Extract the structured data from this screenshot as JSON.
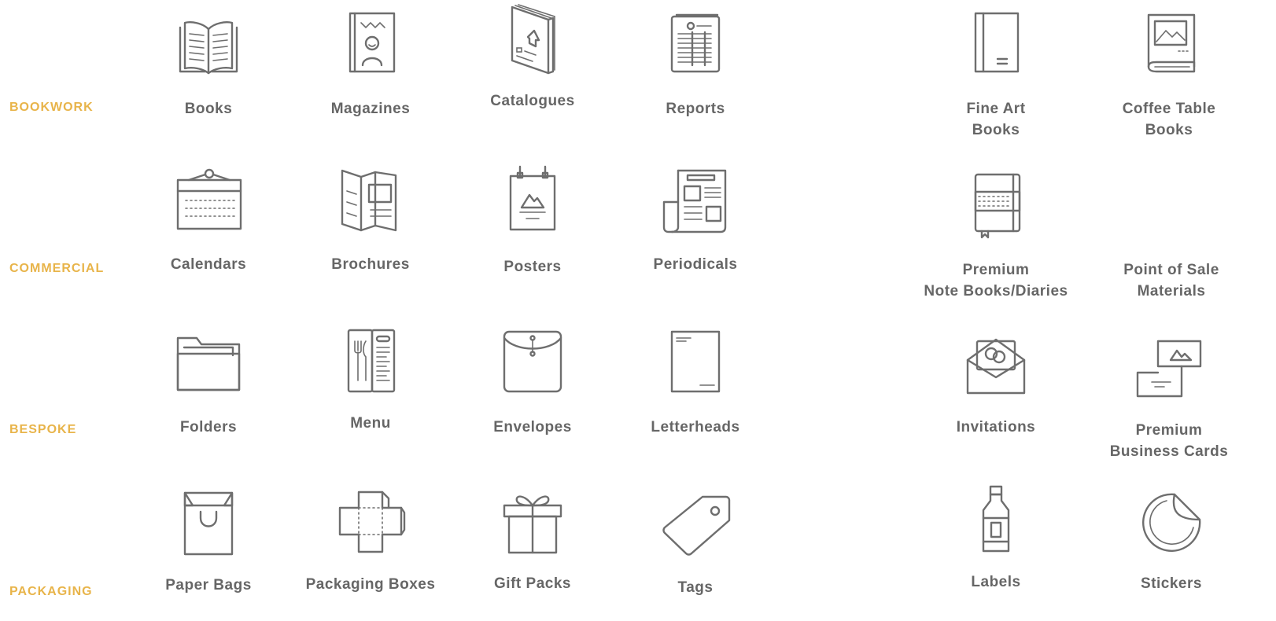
{
  "categories": [
    "BOOKWORK",
    "COMMERCIAL",
    "BESPOKE",
    "PACKAGING"
  ],
  "rows": [
    [
      {
        "label": [
          "Books"
        ],
        "icon": "open-book-icon"
      },
      {
        "label": [
          "Magazines"
        ],
        "icon": "magazine-icon"
      },
      {
        "label": [
          "Catalogues"
        ],
        "icon": "catalogue-stack-icon"
      },
      {
        "label": [
          "Reports"
        ],
        "icon": "report-icon"
      },
      {
        "label": [
          "Fine Art",
          "Books"
        ],
        "icon": "fine-art-book-icon"
      },
      {
        "label": [
          "Coffee Table",
          "Books"
        ],
        "icon": "coffee-table-book-icon"
      }
    ],
    [
      {
        "label": [
          "Calendars"
        ],
        "icon": "calendar-icon"
      },
      {
        "label": [
          "Brochures"
        ],
        "icon": "brochure-icon"
      },
      {
        "label": [
          "Posters"
        ],
        "icon": "poster-icon"
      },
      {
        "label": [
          "Periodicals"
        ],
        "icon": "newspaper-icon"
      },
      {
        "label": [
          "Premium",
          "Note Books/Diaries"
        ],
        "icon": "notebook-icon"
      },
      {
        "label": [
          "Point of Sale",
          "Materials"
        ],
        "icon": ""
      }
    ],
    [
      {
        "label": [
          "Folders"
        ],
        "icon": "folder-icon"
      },
      {
        "label": [
          "Menu"
        ],
        "icon": "menu-card-icon"
      },
      {
        "label": [
          "Envelopes"
        ],
        "icon": "envelope-icon"
      },
      {
        "label": [
          "Letterheads"
        ],
        "icon": "letterhead-icon"
      },
      {
        "label": [
          "Invitations"
        ],
        "icon": "invitation-icon"
      },
      {
        "label": [
          "Premium",
          "Business Cards"
        ],
        "icon": "business-cards-icon"
      }
    ],
    [
      {
        "label": [
          "Paper Bags"
        ],
        "icon": "paper-bag-icon"
      },
      {
        "label": [
          "Packaging Boxes"
        ],
        "icon": "box-dieline-icon"
      },
      {
        "label": [
          "Gift Packs"
        ],
        "icon": "gift-icon"
      },
      {
        "label": [
          "Tags"
        ],
        "icon": "tag-icon"
      },
      {
        "label": [
          "Labels"
        ],
        "icon": "bottle-label-icon"
      },
      {
        "label": [
          "Stickers"
        ],
        "icon": "sticker-icon"
      }
    ]
  ],
  "colors": {
    "category": "#e8b44a",
    "label": "#666666",
    "icon": "#6e6e6e"
  }
}
